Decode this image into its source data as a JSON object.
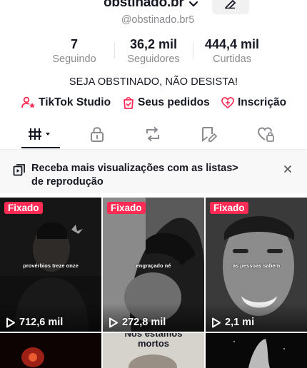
{
  "profile": {
    "username": "obstinado.br",
    "handle": "@obstinado.br5",
    "bio": "SEJA OBSTINADO, NÃO DESISTA!"
  },
  "stats": [
    {
      "value": "7",
      "label": "Seguindo"
    },
    {
      "value": "36,2 mil",
      "label": "Seguidores"
    },
    {
      "value": "444,4 mil",
      "label": "Curtidas"
    }
  ],
  "links": {
    "studio": "TikTok Studio",
    "orders": "Seus pedidos",
    "subscription": "Inscrição"
  },
  "tabs": [
    "videos-grid",
    "private",
    "reposts",
    "favorites",
    "liked"
  ],
  "banner": {
    "text": "Receba mais visualizações com as listas de reprodução",
    "arrow": ">"
  },
  "videos": [
    {
      "pinned": "Fixado",
      "caption": "provérbios treze onze",
      "views": "712,6 mil"
    },
    {
      "pinned": "Fixado",
      "caption": "engraçado né",
      "views": "272,8 mil"
    },
    {
      "pinned": "Fixado",
      "caption": "as pessoas sabem",
      "views": "2,1 mi"
    },
    {
      "caption_line1": "Nós estamos",
      "caption_line2": "mortos"
    }
  ],
  "colors": {
    "accent": "#fe2c55",
    "text": "#161823",
    "muted": "#8a8b91"
  }
}
